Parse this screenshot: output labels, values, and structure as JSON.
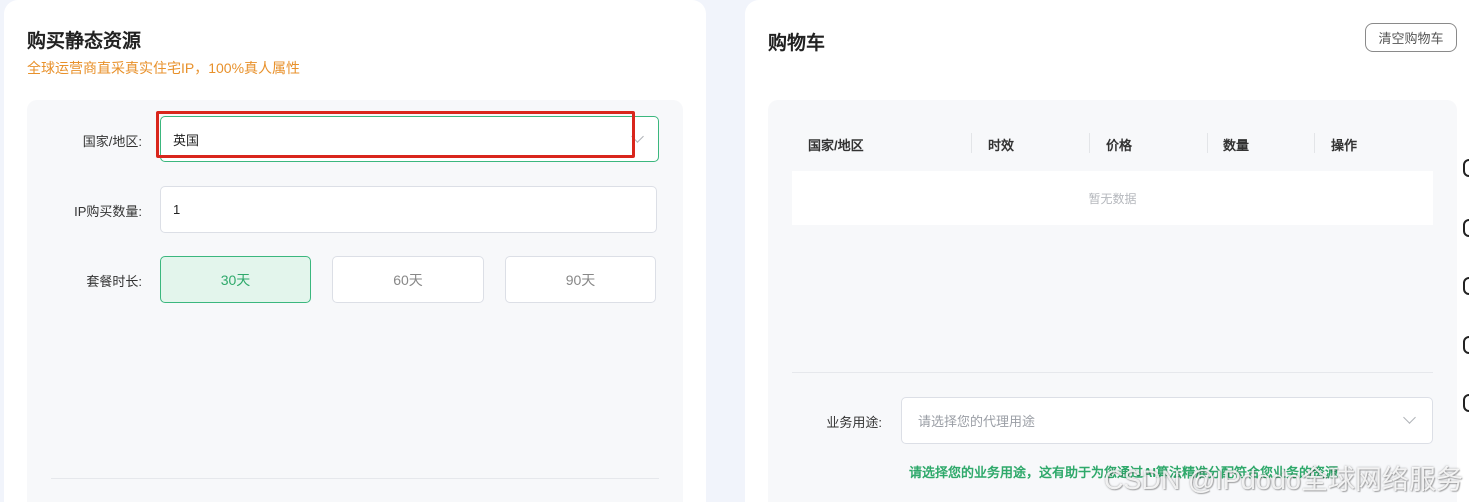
{
  "left_panel": {
    "title": "购买静态资源",
    "subtitle": "全球运营商直采真实住宅IP，100%真人属性",
    "country_label": "国家/地区:",
    "country_value": "英国",
    "quantity_label": "IP购买数量:",
    "quantity_value": "1",
    "duration_label": "套餐时长:",
    "durations": [
      "30天",
      "60天",
      "90天"
    ],
    "selected_duration": "30天"
  },
  "cart": {
    "title": "购物车",
    "clear_button": "清空购物车",
    "columns": [
      "国家/地区",
      "时效",
      "价格",
      "数量",
      "操作"
    ],
    "empty_text": "暂无数据",
    "purpose_label": "业务用途:",
    "purpose_placeholder": "请选择您的代理用途",
    "hint": "请选择您的业务用途，这有助于为您通过AI算法精准分配符合您业务的资源"
  },
  "watermark": "CSDN @IPdodo全球网络服务",
  "colors": {
    "accent_green": "#3bb77e",
    "subtitle_orange": "#e8912b",
    "highlight_red": "#d9261c"
  }
}
